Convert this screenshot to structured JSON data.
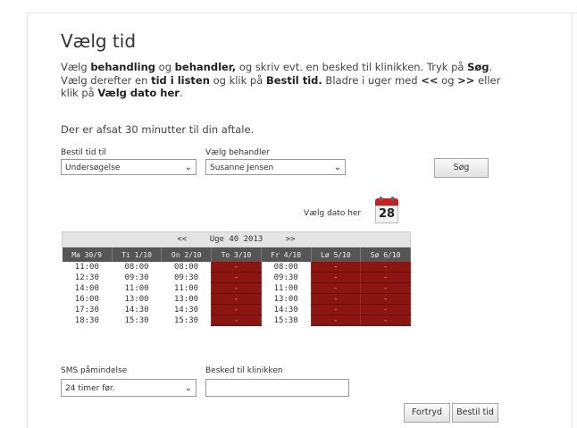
{
  "header": {
    "title": "Vælg tid"
  },
  "intro": {
    "p1": "Vælg ",
    "b1": "behandling",
    "p2": " og ",
    "b2": "behandler,",
    "p3": " og skriv evt. en besked til klinikken. Tryk på ",
    "b3": "Søg",
    "p4": ". Vælg derefter en ",
    "b4": "tid i listen",
    "p5": " og klik på ",
    "b5": "Bestil tid.",
    "p6": " Bladre i uger med ",
    "b6": "<<",
    "p7": " og ",
    "b7": ">>",
    "p8": " eller klik på ",
    "b8": "Vælg dato her",
    "p9": "."
  },
  "note": "Der er afsat 30 minutter til din aftale.",
  "treatment": {
    "label": "Bestil tid til",
    "value": "Undersøgelse"
  },
  "practitioner": {
    "label": "Vælg behandler",
    "value": "Susanne Jensen"
  },
  "search_button": "Søg",
  "date_picker": {
    "label": "Vælg dato her",
    "day": "28"
  },
  "schedule": {
    "prev": "<<",
    "week": "Uge 40 2013",
    "next": ">>",
    "days": [
      "Ma 30/9",
      "Ti 1/10",
      "On 2/10",
      "To 3/10",
      "Fr 4/10",
      "Lø 5/10",
      "Sø 6/10"
    ],
    "rows": [
      [
        "11:00",
        "08:00",
        "08:00",
        "-",
        "08:00",
        "-",
        "-"
      ],
      [
        "12:30",
        "09:30",
        "09:30",
        "-",
        "09:30",
        "-",
        "-"
      ],
      [
        "14:00",
        "11:00",
        "11:00",
        "-",
        "11:00",
        "-",
        "-"
      ],
      [
        "16:00",
        "13:00",
        "13:00",
        "-",
        "13:00",
        "-",
        "-"
      ],
      [
        "17:30",
        "14:30",
        "14:30",
        "-",
        "14:30",
        "-",
        "-"
      ],
      [
        "18:30",
        "15:30",
        "15:30",
        "-",
        "15:30",
        "-",
        "-"
      ]
    ]
  },
  "sms": {
    "label": "SMS påmindelse",
    "value": "24 timer før."
  },
  "message": {
    "label": "Besked til klinikken",
    "value": ""
  },
  "buttons": {
    "cancel": "Fortryd",
    "book": "Bestil tid"
  },
  "colors": {
    "unavailable": "#8b1510",
    "header_bg": "#555555",
    "nav_bg": "#e4e4e4"
  }
}
